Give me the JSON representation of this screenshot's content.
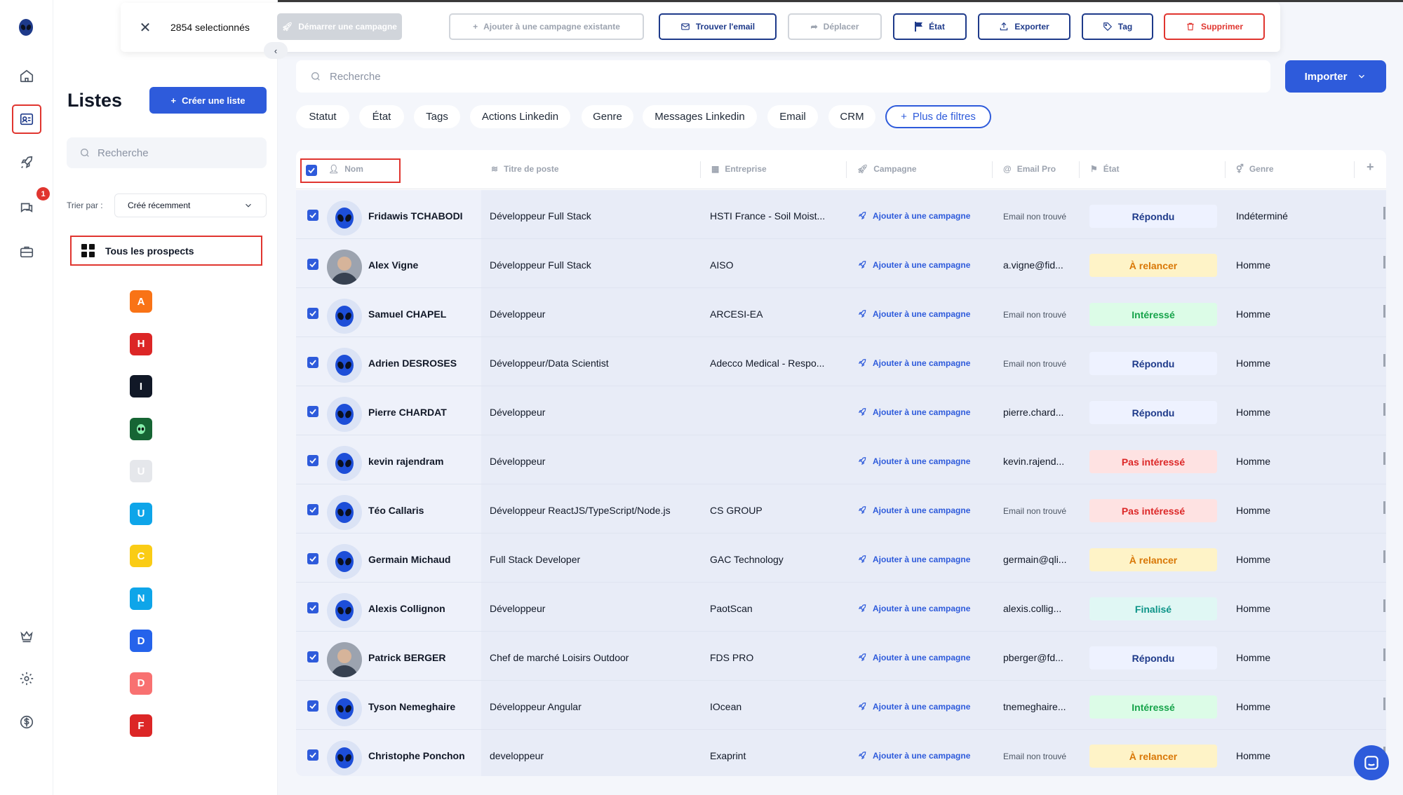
{
  "selection": {
    "count_label": "2854 selectionnés",
    "actions": {
      "start_campaign": "Démarrer une campagne",
      "add_existing": "Ajouter à une campagne existante",
      "find_email": "Trouver l'email",
      "move": "Déplacer",
      "state": "État",
      "export": "Exporter",
      "tag": "Tag",
      "delete": "Supprimer"
    }
  },
  "sidebar": {
    "notification_count": "1"
  },
  "lists_panel": {
    "title": "Listes",
    "create_label": "Créer une liste",
    "search_placeholder": "Recherche",
    "sort_label": "Trier par :",
    "sort_value": "Créé récemment",
    "all_prospects": "Tous les prospects",
    "chips": [
      {
        "letter": "A",
        "color": "#f97316"
      },
      {
        "letter": "H",
        "color": "#dc2626"
      },
      {
        "letter": "I",
        "color": "#111827"
      },
      {
        "letter": "",
        "color": "#166534"
      },
      {
        "letter": "U",
        "color": "#e5e7eb"
      },
      {
        "letter": "U",
        "color": "#0ea5e9"
      },
      {
        "letter": "C",
        "color": "#facc15"
      },
      {
        "letter": "N",
        "color": "#0ea5e9"
      },
      {
        "letter": "D",
        "color": "#2563eb"
      },
      {
        "letter": "D",
        "color": "#f87171"
      },
      {
        "letter": "F",
        "color": "#dc2626"
      }
    ]
  },
  "main": {
    "search_placeholder": "Recherche",
    "import_label": "Importer",
    "filters": [
      "Statut",
      "État",
      "Tags",
      "Actions Linkedin",
      "Genre",
      "Messages Linkedin",
      "Email",
      "CRM"
    ],
    "more_filters": "Plus de filtres",
    "columns": {
      "name": "Nom",
      "job": "Titre de poste",
      "company": "Entreprise",
      "campaign": "Campagne",
      "email": "Email Pro",
      "state": "État",
      "genre": "Genre"
    },
    "add_campaign_label": "Ajouter à une campagne",
    "rows": [
      {
        "name": "Fridawis TCHABODI",
        "job": "Développeur Full Stack",
        "company": "HSTI France - Soil Moist...",
        "email": "Email non trouvé",
        "email_found": false,
        "state": "Répondu",
        "genre": "Indéterminé",
        "photo": false
      },
      {
        "name": "Alex Vigne",
        "job": "Développeur Full Stack",
        "company": "AISO",
        "email": "a.vigne@fid...",
        "email_found": true,
        "state": "À relancer",
        "genre": "Homme",
        "photo": true
      },
      {
        "name": "Samuel CHAPEL",
        "job": "Développeur",
        "company": "ARCESI-EA",
        "email": "Email non trouvé",
        "email_found": false,
        "state": "Intéressé",
        "genre": "Homme",
        "photo": false
      },
      {
        "name": "Adrien DESROSES",
        "job": "Développeur/Data Scientist",
        "company": "Adecco Medical - Respo...",
        "email": "Email non trouvé",
        "email_found": false,
        "state": "Répondu",
        "genre": "Homme",
        "photo": false
      },
      {
        "name": "Pierre CHARDAT",
        "job": "Développeur",
        "company": "",
        "email": "pierre.chard...",
        "email_found": true,
        "state": "Répondu",
        "genre": "Homme",
        "photo": false
      },
      {
        "name": "kevin rajendram",
        "job": "Développeur",
        "company": "",
        "email": "kevin.rajend...",
        "email_found": true,
        "state": "Pas intéressé",
        "genre": "Homme",
        "photo": false
      },
      {
        "name": "Téo Callaris",
        "job": "Développeur ReactJS/TypeScript/Node.js",
        "company": "CS GROUP",
        "email": "Email non trouvé",
        "email_found": false,
        "state": "Pas intéressé",
        "genre": "Homme",
        "photo": false
      },
      {
        "name": "Germain Michaud",
        "job": "Full Stack Developer",
        "company": "GAC Technology",
        "email": "germain@qli...",
        "email_found": true,
        "state": "À relancer",
        "genre": "Homme",
        "photo": false
      },
      {
        "name": "Alexis Collignon",
        "job": "Développeur",
        "company": "PaotScan",
        "email": "alexis.collig...",
        "email_found": true,
        "state": "Finalisé",
        "genre": "Homme",
        "photo": false
      },
      {
        "name": "Patrick BERGER",
        "job": "Chef de marché Loisirs Outdoor",
        "company": "FDS PRO",
        "email": "pberger@fd...",
        "email_found": true,
        "state": "Répondu",
        "genre": "Homme",
        "photo": true
      },
      {
        "name": "Tyson Nemeghaire",
        "job": "Développeur Angular",
        "company": "IOcean",
        "email": "tnemeghaire...",
        "email_found": true,
        "state": "Intéressé",
        "genre": "Homme",
        "photo": false
      },
      {
        "name": "Christophe Ponchon",
        "job": "developpeur",
        "company": "Exaprint",
        "email": "Email non trouvé",
        "email_found": false,
        "state": "À relancer",
        "genre": "Homme",
        "photo": false
      }
    ],
    "state_styles": {
      "Répondu": {
        "bg": "#eef2ff",
        "fg": "#1e3a8a"
      },
      "À relancer": {
        "bg": "#fef3c7",
        "fg": "#d97706"
      },
      "Intéressé": {
        "bg": "#dcfce7",
        "fg": "#16a34a"
      },
      "Pas intéressé": {
        "bg": "#fee2e2",
        "fg": "#dc2626"
      },
      "Finalisé": {
        "bg": "#e0f7f4",
        "fg": "#0d9488"
      }
    }
  }
}
